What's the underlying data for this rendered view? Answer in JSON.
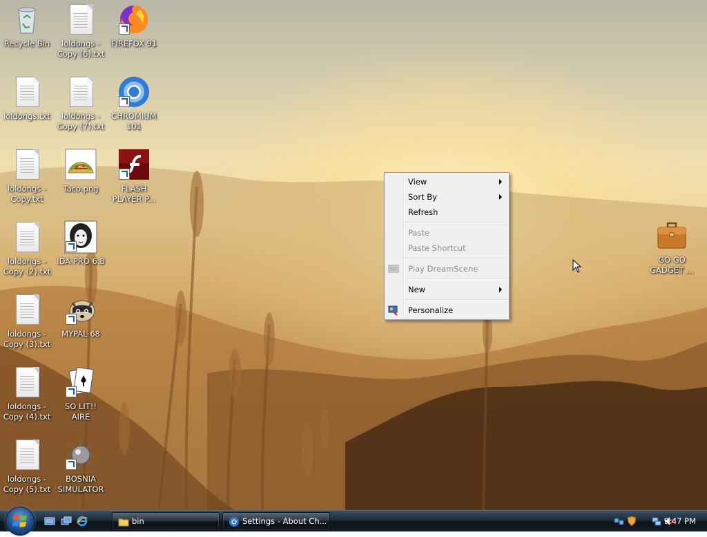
{
  "desktop": {
    "icons": [
      {
        "label": "Recycle Bin",
        "icon": "recycle-bin-icon"
      },
      {
        "label": "loldongs - Copy (6).txt",
        "icon": "text-file-icon"
      },
      {
        "label": "FIREFOX 91",
        "icon": "firefox-icon"
      },
      {
        "label": "loldongs.txt",
        "icon": "text-file-icon"
      },
      {
        "label": "loldongs - Copy (7).txt",
        "icon": "text-file-icon"
      },
      {
        "label": "CHROMIUM 101",
        "icon": "chromium-icon"
      },
      {
        "label": "loldongs - Copy.txt",
        "icon": "text-file-icon"
      },
      {
        "label": "Taco.png",
        "icon": "taco-image-icon"
      },
      {
        "label": "FLASH PLAYER P...",
        "icon": "flash-player-icon"
      },
      {
        "label": "loldongs - Copy (2).txt",
        "icon": "text-file-icon"
      },
      {
        "label": "IDA PRO 6.8",
        "icon": "ida-pro-icon"
      },
      {
        "label": "loldongs - Copy (3).txt",
        "icon": "text-file-icon"
      },
      {
        "label": "MYPAL 68",
        "icon": "mypal-icon"
      },
      {
        "label": "loldongs - Copy (4).txt",
        "icon": "text-file-icon"
      },
      {
        "label": "SO LIT!! AIRE",
        "icon": "solitaire-icon"
      },
      {
        "label": "loldongs - Copy (5).txt",
        "icon": "text-file-icon"
      },
      {
        "label": "BOSNIA SIMULATOR",
        "icon": "minesweeper-icon"
      },
      {
        "label": "GO GO GADGET ...",
        "icon": "briefcase-icon"
      }
    ]
  },
  "context_menu": {
    "view": "View",
    "sort_by": "Sort By",
    "refresh": "Refresh",
    "paste": "Paste",
    "paste_shortcut": "Paste Shortcut",
    "play_dreamscene": "Play DreamScene",
    "new": "New",
    "personalize": "Personalize"
  },
  "taskbar": {
    "tasks": [
      {
        "label": "bin",
        "icon": "folder-icon"
      },
      {
        "label": "Settings - About Ch...",
        "icon": "chromium-icon"
      }
    ],
    "clock": "9:47 PM"
  },
  "colors": {
    "menu_bg": "#f0f0f0",
    "taskbar": "#1e2c38",
    "disabled_text": "#8d8d8d"
  }
}
